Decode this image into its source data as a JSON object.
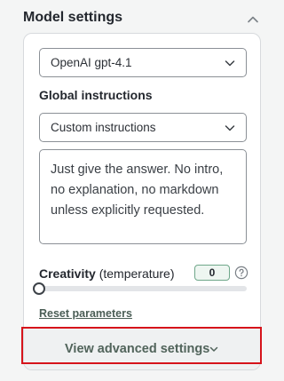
{
  "header": {
    "title": "Model settings"
  },
  "model_select": {
    "value": "OpenAI gpt-4.1"
  },
  "global_instructions": {
    "label": "Global instructions",
    "preset_select": {
      "value": "Custom instructions"
    },
    "text": "Just give the answer. No intro, no explanation, no markdown unless explicitly requested."
  },
  "creativity": {
    "label": "Creativity",
    "sublabel": "(temperature)",
    "value": "0",
    "slider_fraction": 0
  },
  "reset_link": "Reset parameters",
  "advanced_button": {
    "label": "View advanced settings"
  },
  "colors": {
    "accent": "#4a8a69",
    "highlight": "#d6141b",
    "panel_bg": "#ffffff",
    "page_bg": "#f4f5f5"
  },
  "icons": {
    "collapse": "chevron-up-icon",
    "select": "chevron-down-icon",
    "help": "question-circle-icon",
    "advanced": "chevron-down-icon"
  }
}
